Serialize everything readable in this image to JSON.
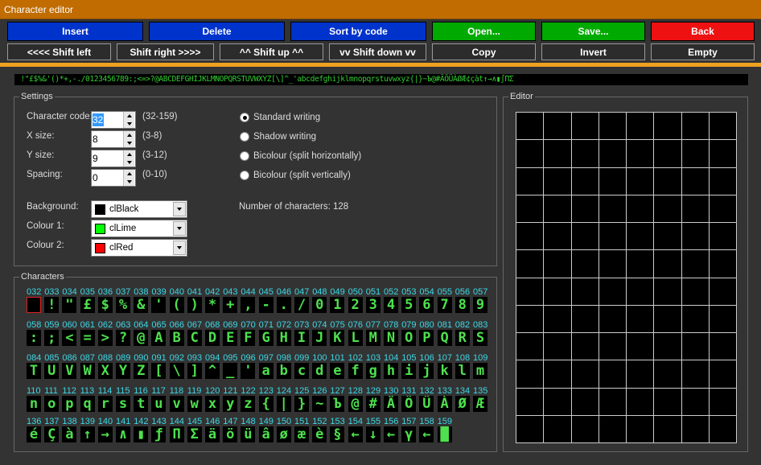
{
  "window": {
    "title": "Character editor"
  },
  "toolbar": {
    "insert": "Insert",
    "delete": "Delete",
    "sort": "Sort by code",
    "open": "Open...",
    "save": "Save...",
    "back": "Back",
    "shift_left": "<<<< Shift left",
    "shift_right": "Shift right >>>>",
    "shift_up": "^^ Shift up ^^",
    "shift_down": "vv Shift down vv",
    "copy": "Copy",
    "invert": "Invert",
    "empty": "Empty",
    "colors": {
      "blue": "#0033cc",
      "green": "#00aa00",
      "red": "#ee1111"
    }
  },
  "charstrip": " !\"£$%&'()*+,-./0123456789:;<=>?@ABCDEFGHIJKLMNOPQRSTUVWXYZ[\\]^_'abcdefghijklmnopqrstuvwxyz{|}~Ъ@#ÄÖÜÀØÆ¢çàt↑→∧▮∫ΠΣ",
  "settings": {
    "group_label": "Settings",
    "char_code_label": "Character code:",
    "char_code_value": "32",
    "char_code_range": "(32-159)",
    "x_size_label": "X size:",
    "x_size_value": "8",
    "x_size_range": "(3-8)",
    "y_size_label": "Y size:",
    "y_size_value": "9",
    "y_size_range": "(3-12)",
    "spacing_label": "Spacing:",
    "spacing_value": "0",
    "spacing_range": "(0-10)",
    "radios": [
      "Standard writing",
      "Shadow writing",
      "Bicolour (split horizontally)",
      "Bicolour (split vertically)"
    ],
    "selected_radio": 0,
    "num_chars": "Number of characters: 128",
    "background_label": "Background:",
    "background_value": "clBlack",
    "background_color": "#000000",
    "colour1_label": "Colour 1:",
    "colour1_value": "clLime",
    "colour1_color": "#00ff00",
    "colour2_label": "Colour 2:",
    "colour2_value": "clRed",
    "colour2_color": "#ff0000"
  },
  "characters": {
    "group_label": "Characters",
    "codes": [
      "032",
      "033",
      "034",
      "035",
      "036",
      "037",
      "038",
      "039",
      "040",
      "041",
      "042",
      "043",
      "044",
      "045",
      "046",
      "047",
      "048",
      "049",
      "050",
      "051",
      "052",
      "053",
      "054",
      "055",
      "056",
      "057",
      "058",
      "059",
      "060",
      "061",
      "062",
      "063",
      "064",
      "065",
      "066",
      "067",
      "068",
      "069",
      "070",
      "071",
      "072",
      "073",
      "074",
      "075",
      "076",
      "077",
      "078",
      "079",
      "080",
      "081",
      "082",
      "083",
      "084",
      "085",
      "086",
      "087",
      "088",
      "089",
      "090",
      "091",
      "092",
      "093",
      "094",
      "095",
      "096",
      "097",
      "098",
      "099",
      "100",
      "101",
      "102",
      "103",
      "104",
      "105",
      "106",
      "107",
      "108",
      "109",
      "110",
      "111",
      "112",
      "113",
      "114",
      "115",
      "116",
      "117",
      "118",
      "119",
      "120",
      "121",
      "122",
      "123",
      "124",
      "125",
      "126",
      "127",
      "128",
      "129",
      "130",
      "131",
      "132",
      "133",
      "134",
      "135",
      "136",
      "137",
      "138",
      "139",
      "140",
      "141",
      "142",
      "143",
      "144",
      "145",
      "146",
      "147",
      "148",
      "149",
      "150",
      "151",
      "152",
      "153",
      "154",
      "155",
      "156",
      "157",
      "158",
      "159"
    ],
    "glyphs": [
      " ",
      "!",
      "\"",
      "£",
      "$",
      "%",
      "&",
      "'",
      "(",
      ")",
      "*",
      "+",
      ",",
      "-",
      ".",
      "/",
      "0",
      "1",
      "2",
      "3",
      "4",
      "5",
      "6",
      "7",
      "8",
      "9",
      ":",
      ";",
      "<",
      "=",
      ">",
      "?",
      "@",
      "A",
      "B",
      "C",
      "D",
      "E",
      "F",
      "G",
      "H",
      "I",
      "J",
      "K",
      "L",
      "M",
      "N",
      "O",
      "P",
      "Q",
      "R",
      "S",
      "T",
      "U",
      "V",
      "W",
      "X",
      "Y",
      "Z",
      "[",
      "\\",
      "]",
      "^",
      "_",
      "'",
      "a",
      "b",
      "c",
      "d",
      "e",
      "f",
      "g",
      "h",
      "i",
      "j",
      "k",
      "l",
      "m",
      "n",
      "o",
      "p",
      "q",
      "r",
      "s",
      "t",
      "u",
      "v",
      "w",
      "x",
      "y",
      "z",
      "{",
      "|",
      "}",
      "~",
      "Ъ",
      "@",
      "#",
      "Ä",
      "Ö",
      "Ü",
      "À",
      "Ø",
      "Æ",
      "é",
      "Ç",
      "à",
      "↑",
      "→",
      "∧",
      "▮",
      "ƒ",
      "Π",
      "Σ",
      "ä",
      "ö",
      "ü",
      "â",
      "ø",
      "æ",
      "è",
      "§",
      "←",
      "↓",
      "←",
      "γ",
      "←",
      "█"
    ],
    "selected_index": 0
  },
  "editor": {
    "group_label": "Editor",
    "columns": 8,
    "rows": 12
  }
}
